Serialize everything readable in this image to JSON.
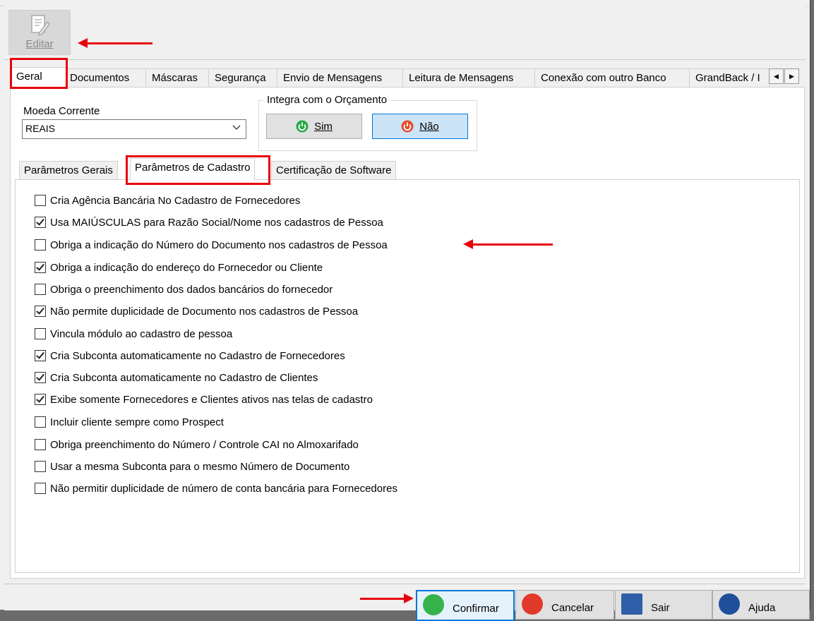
{
  "toolbar": {
    "editar_label": "Editar"
  },
  "main_tabs": [
    {
      "label": "Geral"
    },
    {
      "label": "Documentos"
    },
    {
      "label": "Máscaras"
    },
    {
      "label": "Segurança"
    },
    {
      "label": "Envio de Mensagens"
    },
    {
      "label": "Leitura de Mensagens"
    },
    {
      "label": "Conexão com outro Banco"
    },
    {
      "label": "GrandBack / I"
    }
  ],
  "geral": {
    "moeda_label": "Moeda Corrente",
    "moeda_value": "REAIS",
    "integra_title": "Integra com o Orçamento",
    "sim_label": "Sim",
    "nao_label": "Não"
  },
  "sub_tabs": [
    {
      "label": "Parâmetros Gerais"
    },
    {
      "label": "Parâmetros de Cadastro"
    },
    {
      "label": "Certificação de Software"
    }
  ],
  "options": [
    {
      "label": "Cria Agência Bancária No Cadastro de Fornecedores",
      "checked": false
    },
    {
      "label": "Usa MAIÚSCULAS para Razão Social/Nome nos cadastros de Pessoa",
      "checked": true
    },
    {
      "label": "Obriga a indicação do Número do Documento nos cadastros de Pessoa",
      "checked": false
    },
    {
      "label": "Obriga a indicação do endereço do Fornecedor ou Cliente",
      "checked": true
    },
    {
      "label": "Obriga o preenchimento dos dados bancários do fornecedor",
      "checked": false
    },
    {
      "label": "Não permite duplicidade de Documento nos cadastros de Pessoa",
      "checked": true
    },
    {
      "label": "Vincula módulo ao cadastro de pessoa",
      "checked": false
    },
    {
      "label": "Cria Subconta automaticamente no Cadastro de Fornecedores",
      "checked": true
    },
    {
      "label": "Cria Subconta automaticamente no Cadastro de Clientes",
      "checked": true
    },
    {
      "label": "Exibe somente Fornecedores e Clientes ativos nas telas de cadastro",
      "checked": true
    },
    {
      "label": "Incluir cliente sempre como Prospect",
      "checked": false
    },
    {
      "label": "Obriga preenchimento do Número / Controle CAI no Almoxarifado",
      "checked": false
    },
    {
      "label": "Usar a mesma Subconta para o mesmo Número de Documento",
      "checked": false
    },
    {
      "label": "Não permitir duplicidade de número de conta bancária para Fornecedores",
      "checked": false
    }
  ],
  "buttons": {
    "confirmar": "Confirmar",
    "cancelar": "Cancelar",
    "sair": "Sair",
    "ajuda": "Ajuda"
  },
  "colors": {
    "annotation_red": "#e8000b",
    "focus_blue": "#0078d7"
  }
}
